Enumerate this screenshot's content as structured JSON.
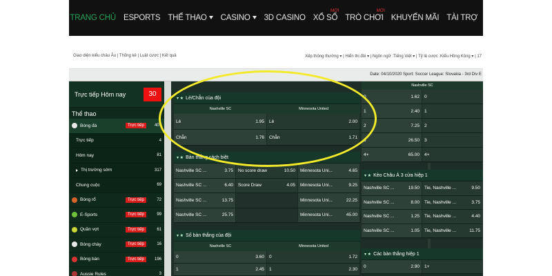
{
  "nav": [
    {
      "label": "TRANG CHỦ",
      "active": true
    },
    {
      "label": "ESPORTS"
    },
    {
      "label": "THỂ THAO",
      "caret": true
    },
    {
      "label": "CASINO",
      "caret": true
    },
    {
      "label": "3D CASINO"
    },
    {
      "label": "XỔ SỐ",
      "badge": "MỚI"
    },
    {
      "label": "TRÒ CHƠI",
      "badge": "MỚI"
    },
    {
      "label": "KHUYẾN MÃI"
    },
    {
      "label": "TÀI TRỢ"
    }
  ],
  "subbar": {
    "left": "Giao diện kiểu châu Âu | Thống kê | Luật cược | Kết quả",
    "right": "Xếp thông thường ▾ | Hiển thị đôi ▾ | Ngôn ngữ :Tiếng Việt ▾ | Tỷ lệ cược :Kiểu Hồng Kông ▾ | 17"
  },
  "datebar": "Date: 04/10/2020 Sport: Soccer League: Slovakia - 3rd Div E",
  "sidebar": {
    "title": "Trực tiếp Hôm nay",
    "count": "30",
    "section": "Thể thao",
    "items": [
      {
        "label": "Bóng đá",
        "live": "Trực tiếp",
        "n": "407",
        "sel": true,
        "color": "#e8e8e8"
      },
      {
        "label": "Trực tiếp",
        "n": "4",
        "sub": true
      },
      {
        "label": "Hôm nay",
        "n": "81",
        "sub": true
      },
      {
        "label": "Thị trường sớm",
        "n": "317",
        "sub": true,
        "tri": true
      },
      {
        "label": "Chung cuộc",
        "n": "69",
        "sub": true
      },
      {
        "label": "Bóng rổ",
        "live": "Trực tiếp",
        "n": "72",
        "color": "#d8632b"
      },
      {
        "label": "E-Sports",
        "live": "Trực tiếp",
        "n": "99",
        "color": "#6fbf3a"
      },
      {
        "label": "Quần vợt",
        "live": "Trực tiếp",
        "n": "61",
        "color": "#cbd63a"
      },
      {
        "label": "Bóng chày",
        "live": "Trực tiếp",
        "n": "16",
        "color": "#e8e8e8"
      },
      {
        "label": "Bóng bàn",
        "live": "Trực tiếp",
        "n": "196",
        "color": "#d33"
      },
      {
        "label": "Aussie Rules",
        "n": "3",
        "color": "#a33"
      }
    ]
  },
  "markets": {
    "le_chan": {
      "title": "Lẻ/Chẵn của đội",
      "home": "Nashville SC",
      "away": "Minnesota United",
      "rows": [
        [
          "Lẻ",
          "1.95",
          "Lẻ",
          "2.00"
        ],
        [
          "Chẵn",
          "1.76",
          "Chẵn",
          "1.71"
        ]
      ]
    },
    "ban_thang": {
      "title": "Bàn thắng cách biệt",
      "rows": [
        [
          "Nashville SC ...",
          "3.75",
          "No score draw",
          "10.50",
          "Minnesota Uni...",
          "4.65"
        ],
        [
          "Nashville SC ...",
          "6.40",
          "Score Draw",
          "4.05",
          "Minnesota Uni...",
          "9.25"
        ],
        [
          "Nashville SC ...",
          "13.75",
          "",
          "",
          "Minnesota Uni...",
          "22.25"
        ],
        [
          "Nashville SC ...",
          "25.75",
          "",
          "",
          "Minnesota Uni...",
          "45.00"
        ]
      ]
    },
    "so_ban": {
      "title": "Số bàn thắng của đội",
      "home": "Nashville SC",
      "away": "Minnesota United",
      "rows": [
        [
          "0",
          "3.60",
          "0",
          "1.72"
        ],
        [
          "1",
          "2.45",
          "1",
          "2.30"
        ]
      ]
    },
    "right_top": {
      "home": "Nashville SC",
      "rows": [
        [
          "0",
          "1.62",
          "0"
        ],
        [
          "1",
          "2.40",
          "1"
        ],
        [
          "2",
          "7.25",
          "2"
        ],
        [
          "3",
          "26.50",
          "3"
        ],
        [
          "4+",
          "65.00",
          "4+"
        ]
      ]
    },
    "keo_chau_a": {
      "title": "Kèo Châu Á 3 cửa hiệp 1",
      "rows": [
        [
          "Nashville SC ...",
          "19.50",
          "Tie, Nashville ...",
          "9.50"
        ],
        [
          "Nashville SC ...",
          "8.00",
          "Tie, Nashville ...",
          "3.75"
        ],
        [
          "Nashville SC ...",
          "1.25",
          "Tie, Nashville ...",
          "4.40"
        ],
        [
          "Nashville SC ...",
          "1.05",
          "Tie, Nashville ...",
          "11.75"
        ]
      ]
    },
    "cac_ban": {
      "title": "Các bàn thắng hiệp 1",
      "rows": [
        [
          "0",
          "2.90",
          "1+"
        ]
      ]
    }
  }
}
